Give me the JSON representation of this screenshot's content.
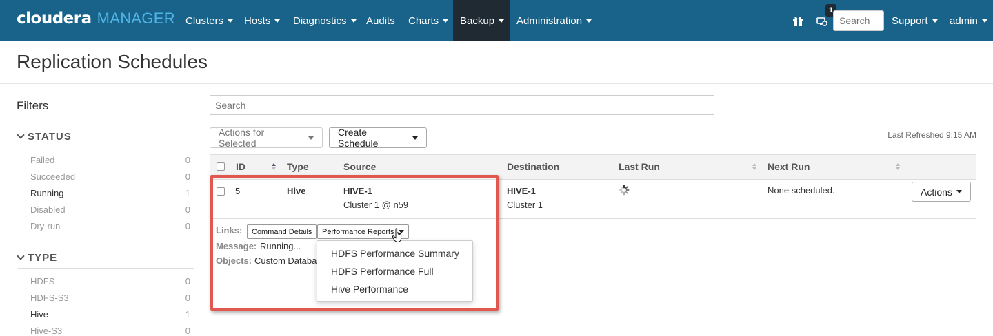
{
  "navbar": {
    "brand": "cloudera",
    "product": "MANAGER",
    "items": [
      {
        "label": "Clusters"
      },
      {
        "label": "Hosts"
      },
      {
        "label": "Diagnostics"
      },
      {
        "label": "Audits"
      },
      {
        "label": "Charts"
      },
      {
        "label": "Backup",
        "active": true
      },
      {
        "label": "Administration"
      }
    ],
    "notification_count": "1",
    "search_placeholder": "Search",
    "support_label": "Support",
    "user_label": "admin",
    "colors": {
      "background": "#19638a",
      "active": "#1f2a33",
      "product": "#4fb4e6"
    }
  },
  "page": {
    "title": "Replication Schedules"
  },
  "filters": {
    "title": "Filters",
    "status": {
      "heading": "STATUS",
      "items": [
        {
          "label": "Failed",
          "count": "0"
        },
        {
          "label": "Succeeded",
          "count": "0"
        },
        {
          "label": "Running",
          "count": "1"
        },
        {
          "label": "Disabled",
          "count": "0"
        },
        {
          "label": "Dry-run",
          "count": "0"
        }
      ]
    },
    "type": {
      "heading": "TYPE",
      "items": [
        {
          "label": "HDFS",
          "count": "0"
        },
        {
          "label": "HDFS-S3",
          "count": "0"
        },
        {
          "label": "Hive",
          "count": "1"
        },
        {
          "label": "Hive-S3",
          "count": "0"
        }
      ]
    }
  },
  "main": {
    "search_placeholder": "Search",
    "actions_for_selected": "Actions for Selected",
    "create_schedule": "Create Schedule",
    "last_refreshed": "Last Refreshed 9:15 AM",
    "table": {
      "columns": [
        "ID",
        "Type",
        "Source",
        "Destination",
        "Last Run",
        "Next Run"
      ],
      "row": {
        "id": "5",
        "type": "Hive",
        "source_name": "HIVE-1",
        "source_detail": "Cluster 1 @ n59",
        "destination_name": "HIVE-1",
        "destination_detail": "Cluster 1",
        "next_run": "None scheduled.",
        "actions_label": "Actions"
      },
      "details": {
        "links_label": "Links:",
        "command_details": "Command Details",
        "performance_reports": "Performance Reports",
        "message_label": "Message:",
        "message_value": "Running...",
        "objects_label": "Objects:",
        "objects_value": "Custom Databa"
      }
    },
    "performance_menu": [
      "HDFS Performance Summary",
      "HDFS Performance Full",
      "Hive Performance"
    ],
    "highlight_color": "#e0584f"
  }
}
